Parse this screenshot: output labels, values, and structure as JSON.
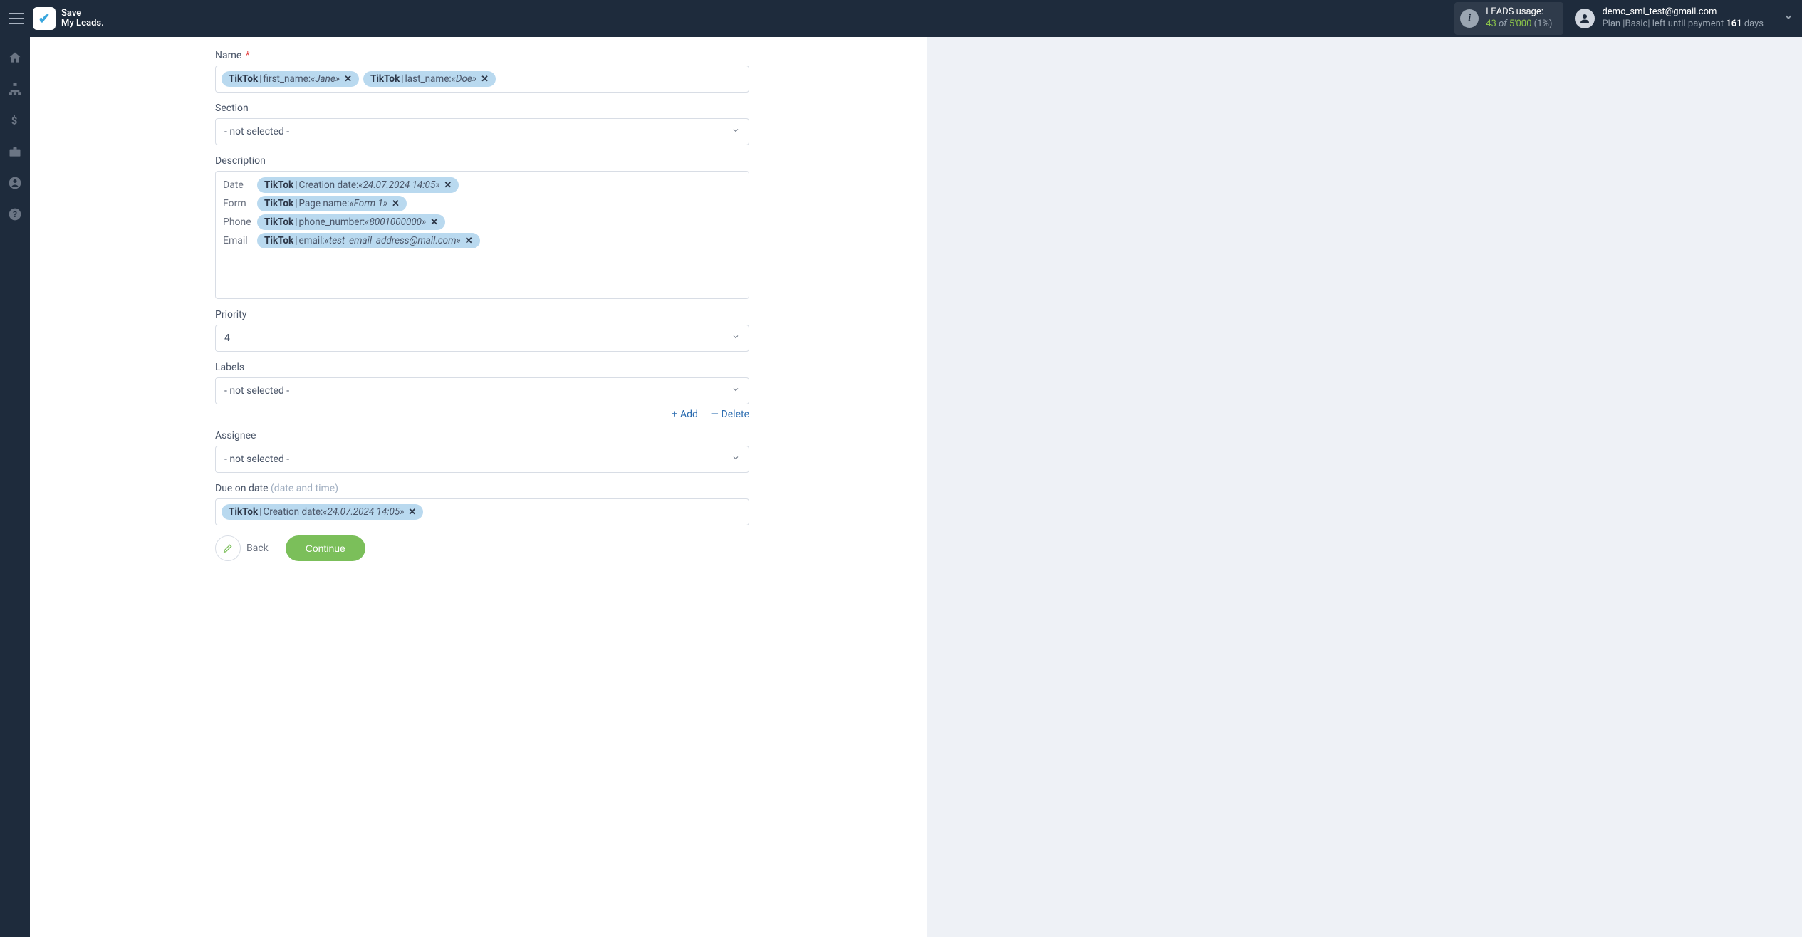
{
  "header": {
    "logo_line1": "Save",
    "logo_line2": "My Leads.",
    "usage": {
      "title": "LEADS usage:",
      "used": "43",
      "of": "of",
      "total": "5'000",
      "pct": "(1%)"
    },
    "user": {
      "email": "demo_sml_test@gmail.com",
      "plan_prefix": "Plan |",
      "plan_name": "Basic",
      "plan_suffix": "| left until payment",
      "days": "161",
      "days_word": "days"
    }
  },
  "sidebar": {
    "items": [
      "home-icon",
      "sitemap-icon",
      "dollar-icon",
      "briefcase-icon",
      "user-circle-icon",
      "question-circle-icon"
    ]
  },
  "form": {
    "name": {
      "label": "Name",
      "chips": [
        {
          "src": "TikTok",
          "fld": "first_name:",
          "val": "«Jane»"
        },
        {
          "src": "TikTok",
          "fld": "last_name:",
          "val": "«Doe»"
        }
      ]
    },
    "section": {
      "label": "Section",
      "value": "- not selected -"
    },
    "description": {
      "label": "Description",
      "rows": [
        {
          "label": "Date",
          "chip": {
            "src": "TikTok",
            "fld": "Creation date:",
            "val": "«24.07.2024 14:05»"
          }
        },
        {
          "label": "Form",
          "chip": {
            "src": "TikTok",
            "fld": "Page name:",
            "val": "«Form 1»"
          }
        },
        {
          "label": "Phone",
          "chip": {
            "src": "TikTok",
            "fld": "phone_number:",
            "val": "«8001000000»"
          }
        },
        {
          "label": "Email",
          "chip": {
            "src": "TikTok",
            "fld": "email:",
            "val": "«test_email_address@mail.com»"
          }
        }
      ]
    },
    "priority": {
      "label": "Priority",
      "value": "4"
    },
    "labels": {
      "label": "Labels",
      "value": "- not selected -",
      "add": "Add",
      "delete": "Delete"
    },
    "assignee": {
      "label": "Assignee",
      "value": "- not selected -"
    },
    "due": {
      "label": "Due on date",
      "hint": "(date and time)",
      "chip": {
        "src": "TikTok",
        "fld": "Creation date:",
        "val": "«24.07.2024 14:05»"
      }
    },
    "buttons": {
      "back": "Back",
      "continue": "Continue"
    }
  }
}
